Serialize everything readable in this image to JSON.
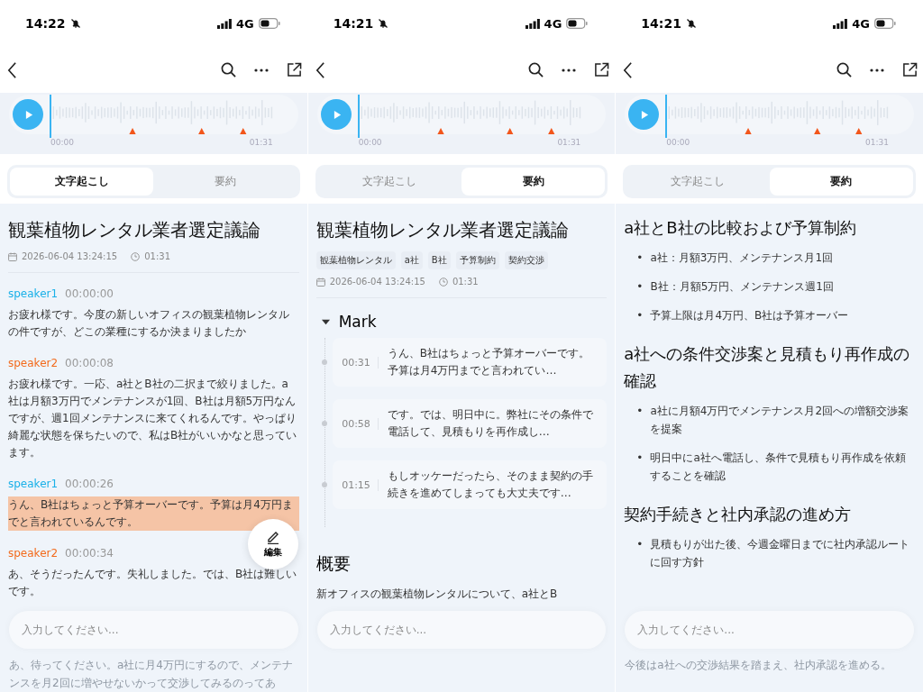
{
  "panels": [
    {
      "status": {
        "time": "14:22",
        "network": "4G"
      },
      "player": {
        "start": "00:00",
        "end": "01:31"
      },
      "tabs": [
        {
          "label": "文字起こし",
          "selected": true
        },
        {
          "label": "要約",
          "selected": false
        }
      ],
      "content": {
        "kind": "transcript",
        "title": "観葉植物レンタル業者選定議論",
        "date": "2026-06-04 13:24:15",
        "duration": "01:31",
        "segments": [
          {
            "speaker": "speaker1",
            "time": "00:00:00",
            "color": "#1ab0e8",
            "highlighted": false,
            "text": "お疲れ様です。今度の新しいオフィスの観葉植物レンタルの件ですが、どこの業種にするか決まりましたか"
          },
          {
            "speaker": "speaker2",
            "time": "00:00:08",
            "color": "#f26a1b",
            "highlighted": false,
            "text": "お疲れ様です。一応、a社とB社の二択まで絞りました。a社は月額3万円でメンテナンスが1回、B社は月額5万円なんですが、週1回メンテナンスに来てくれるんです。やっぱり綺麗な状態を保ちたいので、私はB社がいいかなと思っています。"
          },
          {
            "speaker": "speaker1",
            "time": "00:00:26",
            "color": "#1ab0e8",
            "highlighted": true,
            "text": "うん、B社はちょっと予算オーバーです。予算は月4万円までと言われているんです。"
          },
          {
            "speaker": "speaker2",
            "time": "00:00:34",
            "color": "#f26a1b",
            "highlighted": false,
            "text": "あ、そうだったんです。失礼しました。では、B社は難しいです。"
          }
        ]
      },
      "edit_button": {
        "label": "編集"
      },
      "input": {
        "placeholder": "入力してください..."
      },
      "tail": "あ、待ってください。a社に月4万円にするので、メンテナンスを月2回に増やせないかって交渉してみるのってあ"
    },
    {
      "status": {
        "time": "14:21",
        "network": "4G"
      },
      "player": {
        "start": "00:00",
        "end": "01:31"
      },
      "tabs": [
        {
          "label": "文字起こし",
          "selected": false
        },
        {
          "label": "要約",
          "selected": true
        }
      ],
      "content": {
        "kind": "marks",
        "title": "観葉植物レンタル業者選定議論",
        "tags": [
          "観葉植物レンタル",
          "a社",
          "B社",
          "予算制約",
          "契約交渉"
        ],
        "date": "2026-06-04 13:24:15",
        "duration": "01:31",
        "marks": {
          "label": "Mark",
          "expanded": true,
          "items": [
            {
              "time": "00:31",
              "text": "うん、B社はちょっと予算オーバーです。予算は月4万円までと言われてい…"
            },
            {
              "time": "00:58",
              "text": "です。では、明日中に。弊社にその条件で電話して、見積もりを再作成し…"
            },
            {
              "time": "01:15",
              "text": "もしオッケーだったら、そのまま契約の手続きを進めてしまっても大丈夫です…"
            }
          ]
        },
        "overview": {
          "heading": "概要",
          "text": "新オフィスの観葉植物レンタルについて、a社とB"
        }
      },
      "input": {
        "placeholder": "入力してください..."
      }
    },
    {
      "status": {
        "time": "14:21",
        "network": "4G"
      },
      "player": {
        "start": "00:00",
        "end": "01:31"
      },
      "tabs": [
        {
          "label": "文字起こし",
          "selected": false
        },
        {
          "label": "要約",
          "selected": true
        }
      ],
      "content": {
        "kind": "sections",
        "bullet_mark": "•",
        "sections": [
          {
            "heading": "a社とB社の比較および予算制約",
            "bullets": [
              "a社：月額3万円、メンテナンス月1回",
              "B社：月額5万円、メンテナンス週1回",
              "予算上限は月4万円、B社は予算オーバー"
            ]
          },
          {
            "heading": "a社への条件交渉案と見積もり再作成の確認",
            "bullets": [
              "a社に月額4万円でメンテナンス月2回への増額交渉案を提案",
              "明日中にa社へ電話し、条件で見積もり再作成を依頼することを確認"
            ]
          },
          {
            "heading": "契約手続きと社内承認の進め方",
            "bullets": [
              "見積もりが出た後、今週金曜日までに社内承認ルートに回す方針"
            ]
          }
        ]
      },
      "input": {
        "placeholder": "入力してください..."
      },
      "tail": "今後はa社への交渉結果を踏まえ、社内承認を進める。"
    }
  ]
}
